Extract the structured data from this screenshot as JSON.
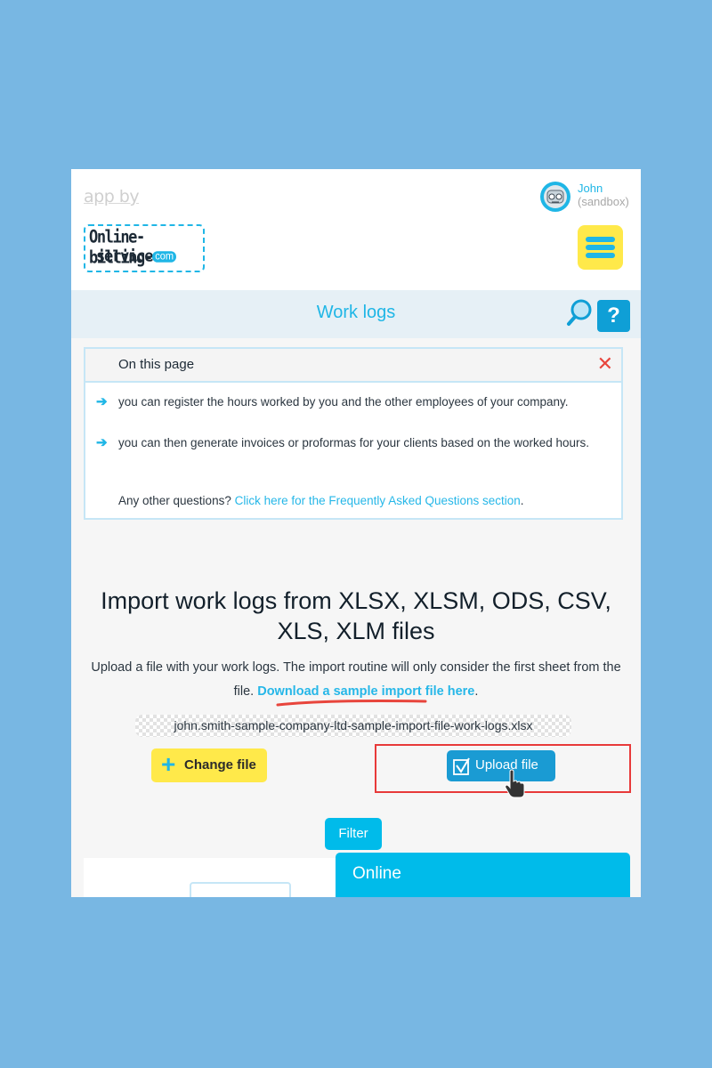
{
  "header": {
    "app_by": "app by",
    "logo": {
      "line1": "Online-billing-",
      "line2": "service",
      "com": "com"
    },
    "user": {
      "name": "John",
      "sub": "(sandbox)"
    },
    "menu_icon": "hamburger-menu-icon"
  },
  "titlebar": {
    "title": "Work logs",
    "search_icon": "magnifier-icon",
    "help_label": "?"
  },
  "info_box": {
    "title": "On this page",
    "close_label": "✕",
    "items": [
      {
        "arrow": "➔",
        "text": "you can register the hours worked by you and the other employees of your company."
      },
      {
        "arrow": "➔",
        "text": "you can then generate invoices or proformas for your clients based on the worked hours."
      }
    ],
    "question": "Any other questions?",
    "faq_link": "Click here for the Frequently Asked Questions section",
    "faq_suffix": "."
  },
  "import": {
    "title": "Import work logs from XLSX, XLSM, ODS, CSV, XLS, XLM files",
    "description": "Upload a file with your work logs. The import routine will only consider the first sheet from the file.",
    "sample_link": "Download a sample import file here",
    "sample_suffix": ".",
    "filename": "john.smith-sample-company-ltd-sample-import-file-work-logs.xlsx",
    "change_button": {
      "icon": "+",
      "label": "Change file"
    },
    "upload_button": {
      "label": "Upload file"
    }
  },
  "filter": {
    "label": "Filter"
  },
  "tabs": {
    "online": "Online"
  },
  "colors": {
    "background": "#78b7e3",
    "accent": "#1fb6e6",
    "yellow": "#ffe94a",
    "upload_blue": "#1a9bd3",
    "highlight_red": "#e83a3a",
    "close_red": "#e8453c"
  }
}
